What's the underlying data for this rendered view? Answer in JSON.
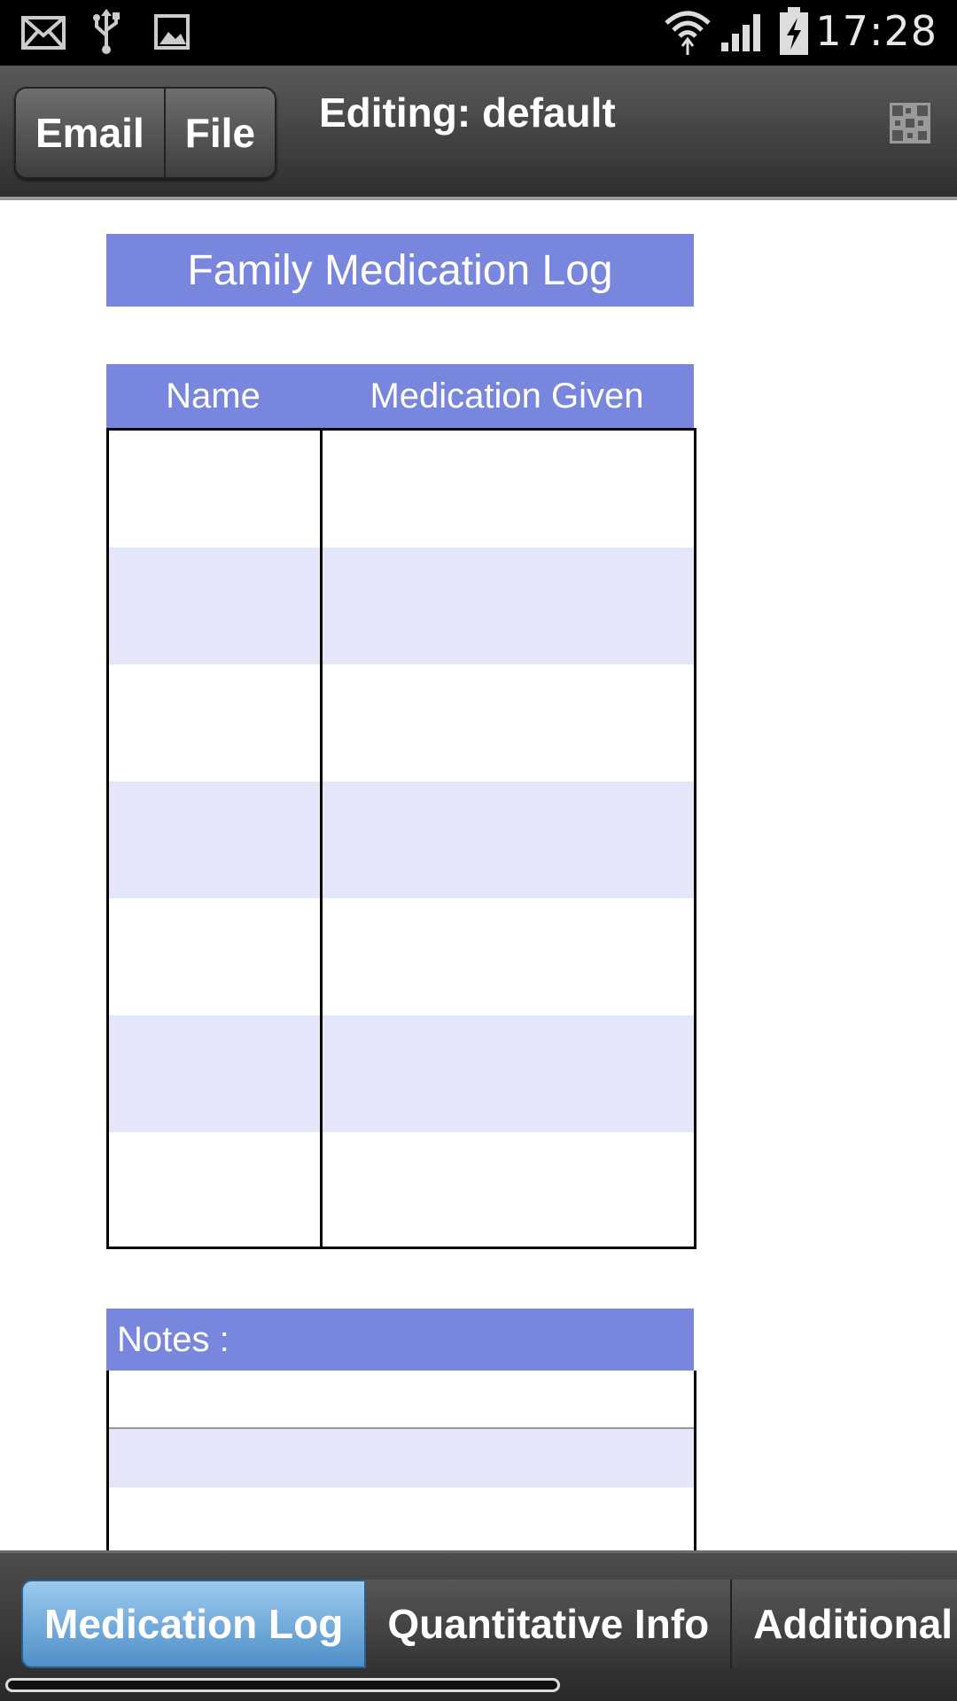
{
  "status_bar": {
    "time": "17:28",
    "icons": [
      "email-icon",
      "usb-icon",
      "image-icon",
      "wifi-icon",
      "signal-icon",
      "battery-charging-icon"
    ]
  },
  "toolbar": {
    "email_label": "Email",
    "file_label": "File",
    "title": "Editing: default",
    "icon": "qr-code-icon"
  },
  "form": {
    "title": "Family Medication Log",
    "table": {
      "columns": [
        "Name",
        "Medication Given"
      ],
      "rows": [
        {
          "name": "",
          "medication": ""
        },
        {
          "name": "",
          "medication": ""
        },
        {
          "name": "",
          "medication": ""
        },
        {
          "name": "",
          "medication": ""
        },
        {
          "name": "",
          "medication": ""
        },
        {
          "name": "",
          "medication": ""
        },
        {
          "name": "",
          "medication": ""
        }
      ]
    },
    "notes_label": "Notes :"
  },
  "tabs": [
    {
      "label": "Medication Log",
      "active": true
    },
    {
      "label": "Quantitative Info",
      "active": false
    },
    {
      "label": "Additional Info",
      "active": false
    }
  ],
  "colors": {
    "header_blue": "#7986de",
    "alt_row": "#e4e6f9",
    "active_tab": "#6aa8dc"
  }
}
